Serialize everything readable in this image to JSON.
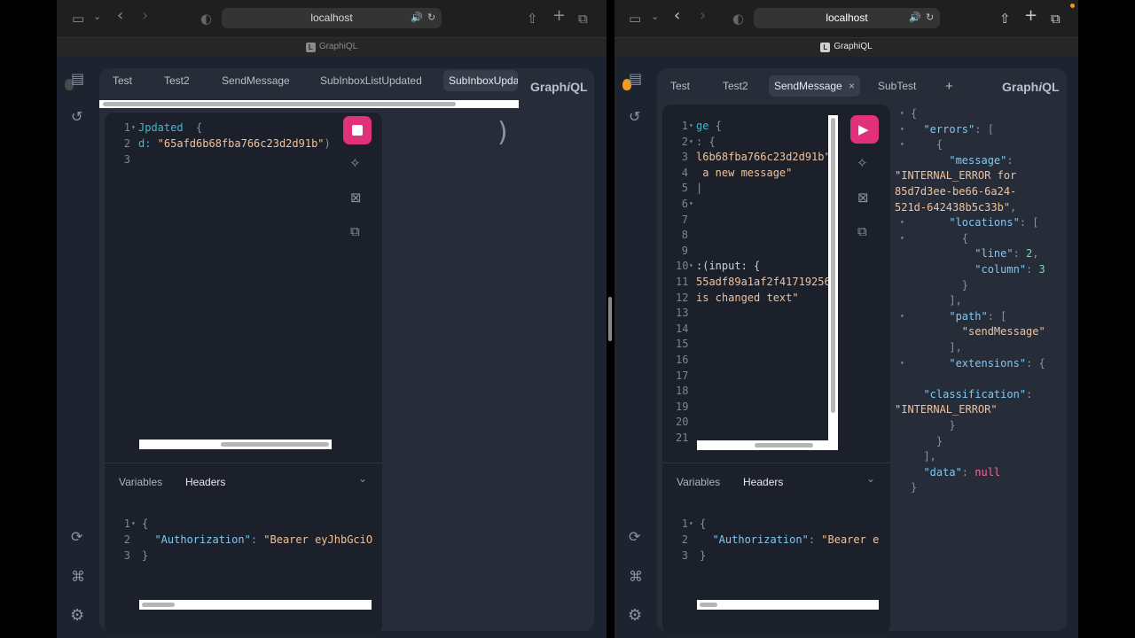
{
  "left": {
    "url": "localhost",
    "tab_title": "GraphiQL",
    "logo": {
      "a": "Graph",
      "b": "i",
      "c": "QL"
    },
    "tabs": [
      "Test",
      "Test2",
      "SendMessage",
      "SubInboxListUpdated",
      "SubInboxUpda"
    ],
    "selected_tab": 4,
    "query_lines": [
      {
        "n": "1",
        "fold": "▾",
        "parts": [
          {
            "c": "kw",
            "t": "Jpdated"
          },
          {
            "c": "punct",
            "t": "  {"
          }
        ]
      },
      {
        "n": "2",
        "fold": "",
        "parts": [
          {
            "c": "kw",
            "t": "d:"
          },
          {
            "c": "str",
            "t": " \"65afd6b68fba766c23d2d91b\""
          },
          {
            "c": "punct",
            "t": ")"
          }
        ]
      },
      {
        "n": "3",
        "fold": "",
        "parts": []
      }
    ],
    "sub_tabs": {
      "variables": "Variables",
      "headers": "Headers"
    },
    "header_lines": [
      {
        "n": "1",
        "fold": "▾",
        "parts": [
          {
            "c": "punct",
            "t": "{"
          }
        ]
      },
      {
        "n": "2",
        "fold": "",
        "parts": [
          {
            "c": "key",
            "t": "  \"Authorization\""
          },
          {
            "c": "punct",
            "t": ": "
          },
          {
            "c": "str",
            "t": "\"Bearer eyJhbGciO"
          }
        ]
      },
      {
        "n": "3",
        "fold": "",
        "parts": [
          {
            "c": "punct",
            "t": "}"
          }
        ]
      }
    ]
  },
  "right": {
    "url": "localhost",
    "tab_title": "GraphiQL",
    "logo": {
      "a": "Graph",
      "b": "i",
      "c": "QL"
    },
    "tabs": [
      "Test",
      "Test2",
      "SendMessage",
      "SubTest"
    ],
    "selected_tab": 2,
    "close_glyph": "×",
    "add_tab": "+",
    "query_lines": [
      {
        "n": "1",
        "fold": "▾",
        "parts": [
          {
            "c": "kw",
            "t": "ge"
          },
          {
            "c": "punct",
            "t": " {"
          }
        ]
      },
      {
        "n": "2",
        "fold": "▾",
        "parts": [
          {
            "c": "punct",
            "t": ": {"
          }
        ]
      },
      {
        "n": "3",
        "fold": "",
        "parts": [
          {
            "c": "str",
            "t": "l6b68fba766c23d2d91b\""
          }
        ]
      },
      {
        "n": "4",
        "fold": "",
        "parts": [
          {
            "c": "str",
            "t": " a new message\""
          }
        ]
      },
      {
        "n": "5",
        "fold": "",
        "parts": [
          {
            "c": "punct",
            "t": "|"
          }
        ]
      },
      {
        "n": "6",
        "fold": "▾",
        "parts": []
      },
      {
        "n": "7",
        "fold": "",
        "parts": []
      },
      {
        "n": "8",
        "fold": "",
        "parts": []
      },
      {
        "n": "9",
        "fold": "",
        "parts": []
      },
      {
        "n": "10",
        "fold": "▾",
        "parts": [
          {
            "c": "txt",
            "t": ":(input: {"
          }
        ]
      },
      {
        "n": "11",
        "fold": "",
        "parts": [
          {
            "c": "str",
            "t": "55adf89a1af2f41719256"
          }
        ]
      },
      {
        "n": "12",
        "fold": "",
        "parts": [
          {
            "c": "str",
            "t": "is changed text\""
          }
        ]
      },
      {
        "n": "13",
        "fold": "",
        "parts": []
      },
      {
        "n": "14",
        "fold": "",
        "parts": []
      },
      {
        "n": "15",
        "fold": "",
        "parts": []
      },
      {
        "n": "16",
        "fold": "",
        "parts": []
      },
      {
        "n": "17",
        "fold": "",
        "parts": []
      },
      {
        "n": "18",
        "fold": "",
        "parts": []
      },
      {
        "n": "19",
        "fold": "",
        "parts": []
      },
      {
        "n": "20",
        "fold": "",
        "parts": []
      },
      {
        "n": "21",
        "fold": "",
        "parts": []
      }
    ],
    "sub_tabs": {
      "variables": "Variables",
      "headers": "Headers"
    },
    "header_lines": [
      {
        "n": "1",
        "fold": "▾",
        "parts": [
          {
            "c": "punct",
            "t": "{"
          }
        ]
      },
      {
        "n": "2",
        "fold": "",
        "parts": [
          {
            "c": "key",
            "t": "  \"Authorization\""
          },
          {
            "c": "punct",
            "t": ": "
          },
          {
            "c": "str",
            "t": "\"Bearer e"
          }
        ]
      },
      {
        "n": "3",
        "fold": "",
        "parts": [
          {
            "c": "punct",
            "t": "}"
          }
        ]
      }
    ],
    "result_lines": [
      {
        "fold": "▾",
        "parts": [
          {
            "c": "punct",
            "t": "{"
          }
        ]
      },
      {
        "fold": "▾",
        "parts": [
          {
            "c": "key",
            "t": "  \"errors\""
          },
          {
            "c": "punct",
            "t": ": ["
          }
        ]
      },
      {
        "fold": "▾",
        "parts": [
          {
            "c": "punct",
            "t": "    {"
          }
        ]
      },
      {
        "fold": "",
        "parts": [
          {
            "c": "key",
            "t": "      \"message\""
          },
          {
            "c": "punct",
            "t": ":"
          }
        ]
      },
      {
        "fold": "",
        "indent": true,
        "parts": [
          {
            "c": "str",
            "t": "\"INTERNAL_ERROR for"
          }
        ]
      },
      {
        "fold": "",
        "indent": true,
        "parts": [
          {
            "c": "str",
            "t": "85d7d3ee-be66-6a24-"
          }
        ]
      },
      {
        "fold": "",
        "indent": true,
        "parts": [
          {
            "c": "str",
            "t": "521d-642438b5c33b\""
          },
          {
            "c": "punct",
            "t": ","
          }
        ]
      },
      {
        "fold": "▾",
        "parts": [
          {
            "c": "key",
            "t": "      \"locations\""
          },
          {
            "c": "punct",
            "t": ": ["
          }
        ]
      },
      {
        "fold": "▾",
        "parts": [
          {
            "c": "punct",
            "t": "        {"
          }
        ]
      },
      {
        "fold": "",
        "parts": [
          {
            "c": "key",
            "t": "          \"line\""
          },
          {
            "c": "punct",
            "t": ": "
          },
          {
            "c": "num",
            "t": "2"
          },
          {
            "c": "punct",
            "t": ","
          }
        ]
      },
      {
        "fold": "",
        "parts": [
          {
            "c": "key",
            "t": "          \"column\""
          },
          {
            "c": "punct",
            "t": ": "
          },
          {
            "c": "num",
            "t": "3"
          }
        ]
      },
      {
        "fold": "",
        "parts": [
          {
            "c": "punct",
            "t": "        }"
          }
        ]
      },
      {
        "fold": "",
        "parts": [
          {
            "c": "punct",
            "t": "      ],"
          }
        ]
      },
      {
        "fold": "▾",
        "parts": [
          {
            "c": "key",
            "t": "      \"path\""
          },
          {
            "c": "punct",
            "t": ": ["
          }
        ]
      },
      {
        "fold": "",
        "parts": [
          {
            "c": "str",
            "t": "        \"sendMessage\""
          }
        ]
      },
      {
        "fold": "",
        "parts": [
          {
            "c": "punct",
            "t": "      ],"
          }
        ]
      },
      {
        "fold": "▾",
        "parts": [
          {
            "c": "key",
            "t": "      \"extensions\""
          },
          {
            "c": "punct",
            "t": ": {"
          }
        ]
      },
      {
        "fold": "",
        "parts": []
      },
      {
        "fold": "",
        "parts": [
          {
            "c": "key",
            "t": "  \"classification\""
          },
          {
            "c": "punct",
            "t": ":"
          }
        ]
      },
      {
        "fold": "",
        "indent": true,
        "parts": [
          {
            "c": "str",
            "t": "\"INTERNAL_ERROR\""
          }
        ]
      },
      {
        "fold": "",
        "parts": [
          {
            "c": "punct",
            "t": "      }"
          }
        ]
      },
      {
        "fold": "",
        "parts": [
          {
            "c": "punct",
            "t": "    }"
          }
        ]
      },
      {
        "fold": "",
        "parts": [
          {
            "c": "punct",
            "t": "  ],"
          }
        ]
      },
      {
        "fold": "",
        "parts": [
          {
            "c": "key",
            "t": "  \"data\""
          },
          {
            "c": "punct",
            "t": ": "
          },
          {
            "c": "nul",
            "t": "null"
          }
        ]
      },
      {
        "fold": "",
        "parts": [
          {
            "c": "punct",
            "t": "}"
          }
        ]
      }
    ]
  },
  "icons": {
    "sidebar_toggle": "▭",
    "chevron_down": "⌄",
    "back": "‹",
    "forward": "›",
    "shield": "◐",
    "speaker": "🔊",
    "reload": "↻",
    "share": "⇧",
    "new_tab": "+",
    "tabs_overview": "⧉",
    "docs": "▤",
    "history": "↺",
    "refetch": "⟳",
    "shortcuts": "⌘",
    "settings": "⚙",
    "prettify": "✧",
    "merge": "⊠",
    "copy": "⧉",
    "play": "▶",
    "spinner": ")"
  },
  "colors": {
    "run": "#e0317a",
    "keyword": "#3fb9d2",
    "string": "#f0c29b",
    "key": "#83c7f0",
    "null": "#f06b9e",
    "fire": "#f39b1c"
  }
}
